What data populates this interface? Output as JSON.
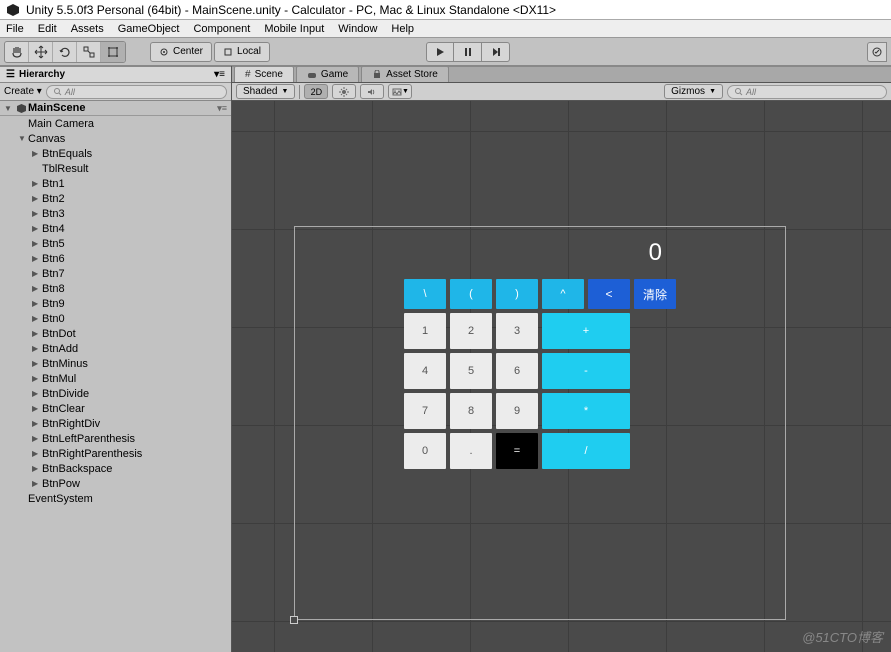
{
  "window": {
    "title": "Unity 5.5.0f3 Personal (64bit) - MainScene.unity - Calculator - PC, Mac & Linux Standalone <DX11>"
  },
  "menu": [
    "File",
    "Edit",
    "Assets",
    "GameObject",
    "Component",
    "Mobile Input",
    "Window",
    "Help"
  ],
  "toolbar": {
    "center": "Center",
    "local": "Local"
  },
  "hierarchy": {
    "tab": "Hierarchy",
    "create": "Create",
    "search_placeholder": "All",
    "scene": "MainScene",
    "items": [
      {
        "label": "Main Camera",
        "arrow": "",
        "indent": 1
      },
      {
        "label": "Canvas",
        "arrow": "▼",
        "indent": 1
      },
      {
        "label": "BtnEquals",
        "arrow": "▶",
        "indent": 2
      },
      {
        "label": "TblResult",
        "arrow": "",
        "indent": 2
      },
      {
        "label": "Btn1",
        "arrow": "▶",
        "indent": 2
      },
      {
        "label": "Btn2",
        "arrow": "▶",
        "indent": 2
      },
      {
        "label": "Btn3",
        "arrow": "▶",
        "indent": 2
      },
      {
        "label": "Btn4",
        "arrow": "▶",
        "indent": 2
      },
      {
        "label": "Btn5",
        "arrow": "▶",
        "indent": 2
      },
      {
        "label": "Btn6",
        "arrow": "▶",
        "indent": 2
      },
      {
        "label": "Btn7",
        "arrow": "▶",
        "indent": 2
      },
      {
        "label": "Btn8",
        "arrow": "▶",
        "indent": 2
      },
      {
        "label": "Btn9",
        "arrow": "▶",
        "indent": 2
      },
      {
        "label": "Btn0",
        "arrow": "▶",
        "indent": 2
      },
      {
        "label": "BtnDot",
        "arrow": "▶",
        "indent": 2
      },
      {
        "label": "BtnAdd",
        "arrow": "▶",
        "indent": 2
      },
      {
        "label": "BtnMinus",
        "arrow": "▶",
        "indent": 2
      },
      {
        "label": "BtnMul",
        "arrow": "▶",
        "indent": 2
      },
      {
        "label": "BtnDivide",
        "arrow": "▶",
        "indent": 2
      },
      {
        "label": "BtnClear",
        "arrow": "▶",
        "indent": 2
      },
      {
        "label": "BtnRightDiv",
        "arrow": "▶",
        "indent": 2
      },
      {
        "label": "BtnLeftParenthesis",
        "arrow": "▶",
        "indent": 2
      },
      {
        "label": "BtnRightParenthesis",
        "arrow": "▶",
        "indent": 2
      },
      {
        "label": "BtnBackspace",
        "arrow": "▶",
        "indent": 2
      },
      {
        "label": "BtnPow",
        "arrow": "▶",
        "indent": 2
      },
      {
        "label": "EventSystem",
        "arrow": "",
        "indent": 1
      }
    ]
  },
  "scene": {
    "tabs": [
      {
        "label": "Scene",
        "icon": "scene"
      },
      {
        "label": "Game",
        "icon": "game"
      },
      {
        "label": "Asset Store",
        "icon": "store"
      }
    ],
    "shaded": "Shaded",
    "mode2d": "2D",
    "gizmos": "Gizmos",
    "search_placeholder": "All"
  },
  "calculator": {
    "display": "0",
    "top_row": [
      "\\",
      "(",
      ")",
      "^",
      "<",
      "清除"
    ],
    "rows": [
      [
        "1",
        "2",
        "3",
        "+"
      ],
      [
        "4",
        "5",
        "6",
        "-"
      ],
      [
        "7",
        "8",
        "9",
        "*"
      ],
      [
        "0",
        ".",
        "=",
        "/"
      ]
    ]
  },
  "watermark": "@51CTO博客"
}
